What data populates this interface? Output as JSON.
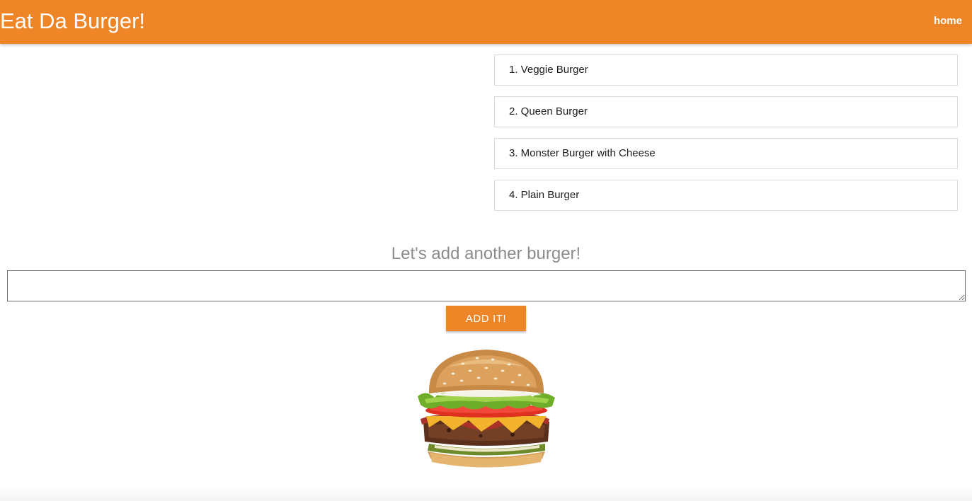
{
  "navbar": {
    "brand": "Eat Da Burger!",
    "home_link": "home",
    "color": "#ee8527"
  },
  "burgers": [
    {
      "label": "1. Veggie Burger"
    },
    {
      "label": "2. Queen Burger"
    },
    {
      "label": "3. Monster Burger with Cheese"
    },
    {
      "label": "4. Plain Burger"
    }
  ],
  "form": {
    "title": "Let's add another burger!",
    "input_value": "",
    "button_label": "ADD IT!"
  },
  "image": {
    "icon": "cheeseburger-image"
  }
}
